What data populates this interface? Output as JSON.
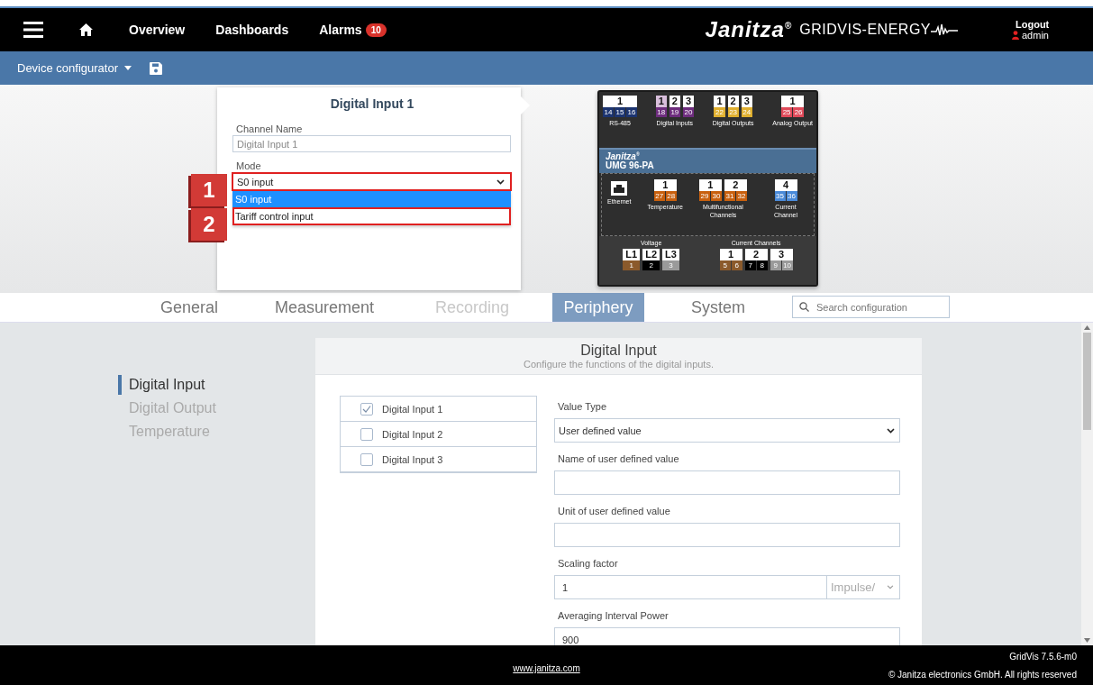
{
  "header": {
    "nav": [
      {
        "kind": "menu"
      },
      {
        "kind": "home"
      },
      {
        "kind": "link",
        "label": "Overview"
      },
      {
        "kind": "link",
        "label": "Dashboards"
      },
      {
        "kind": "link",
        "label": "Alarms",
        "badge": "10"
      }
    ],
    "logo": "Janitza$^{®}$",
    "product": "GRIDVIS-ENERGY",
    "logout": "Logout",
    "user": "admin"
  },
  "toolbar": {
    "menu": "Device configurator"
  },
  "popup": {
    "title": "Digital Input 1",
    "channel_label": "Channel Name",
    "channel_value": "Digital Input 1",
    "mode_label": "Mode",
    "mode_value": "S0 input",
    "mode_highlighted": true,
    "options": [
      {
        "label": "S0 input",
        "selected": true,
        "highlighted": false
      },
      {
        "label": "Tariff control input",
        "selected": false,
        "highlighted": true
      }
    ]
  },
  "callouts": [
    {
      "number": "1"
    },
    {
      "number": "2"
    }
  ],
  "device": {
    "brand": "Janitza$^{®}$",
    "model": "UMG 96-PA",
    "top": [
      {
        "kind": "terminals",
        "label": "RS-485",
        "blocks": [
          {
            "number": "1",
            "selected": false,
            "terminals": [
              {
                "label": "14",
                "color": "#1c3470"
              },
              {
                "label": "15",
                "color": "#1c3470"
              },
              {
                "label": "16",
                "color": "#1c3470"
              }
            ]
          }
        ]
      },
      {
        "kind": "terminals",
        "label": "Digital Inputs",
        "blocks": [
          {
            "number": "1",
            "selected": true,
            "terminals": [
              {
                "label": "18",
                "color": "#6e2d7e"
              }
            ]
          },
          {
            "number": "2",
            "selected": false,
            "terminals": [
              {
                "label": "19",
                "color": "#6e2d7e"
              }
            ]
          },
          {
            "number": "3",
            "selected": false,
            "terminals": [
              {
                "label": "20",
                "color": "#6e2d7e"
              }
            ]
          }
        ]
      },
      {
        "kind": "terminals",
        "label": "Digital Outputs",
        "blocks": [
          {
            "number": "1",
            "selected": false,
            "terminals": [
              {
                "label": "22",
                "color": "#e0b030"
              }
            ]
          },
          {
            "number": "2",
            "selected": false,
            "terminals": [
              {
                "label": "23",
                "color": "#e0b030"
              }
            ]
          },
          {
            "number": "3",
            "selected": false,
            "terminals": [
              {
                "label": "24",
                "color": "#e0b030"
              }
            ]
          }
        ]
      },
      {
        "kind": "terminals",
        "label": "Analog Output",
        "blocks": [
          {
            "number": "1",
            "selected": false,
            "terminals": [
              {
                "label": "25",
                "color": "#e04a5a"
              },
              {
                "label": "26",
                "color": "#e04a5a"
              }
            ]
          }
        ]
      }
    ],
    "middle": [
      {
        "kind": "ethernet",
        "label": "Ethernet"
      },
      {
        "kind": "terminals",
        "label": "Temperature",
        "blocks": [
          {
            "number": "1",
            "selected": false,
            "terminals": [
              {
                "label": "27",
                "color": "#c8600e"
              },
              {
                "label": "28",
                "color": "#c8600e"
              }
            ]
          }
        ]
      },
      {
        "kind": "terminals",
        "label": "Multifunctional Channels",
        "blocks": [
          {
            "number": "1",
            "selected": false,
            "terminals": [
              {
                "label": "29",
                "color": "#c8600e"
              },
              {
                "label": "30",
                "color": "#c8600e"
              }
            ]
          },
          {
            "number": "2",
            "selected": false,
            "terminals": [
              {
                "label": "31",
                "color": "#c8600e"
              },
              {
                "label": "32",
                "color": "#c8600e"
              }
            ]
          }
        ]
      },
      {
        "kind": "terminals",
        "label": "Current Channel",
        "blocks": [
          {
            "number": "4",
            "selected": false,
            "terminals": [
              {
                "label": "35",
                "color": "#4a8ad8"
              },
              {
                "label": "36",
                "color": "#4a8ad8"
              }
            ]
          }
        ]
      }
    ],
    "bottom": [
      {
        "kind": "terminals",
        "label": "Voltage",
        "blocks": [
          {
            "number": "L1",
            "selected": false,
            "terminals": [
              {
                "label": "1",
                "color": "#8b5a2b"
              }
            ]
          },
          {
            "number": "L2",
            "selected": false,
            "terminals": [
              {
                "label": "2",
                "color": "#000000"
              }
            ]
          },
          {
            "number": "L3",
            "selected": false,
            "terminals": [
              {
                "label": "3",
                "color": "#9a9a9a"
              }
            ]
          }
        ]
      },
      {
        "kind": "terminals",
        "label": "Current Channels",
        "blocks": [
          {
            "number": "1",
            "selected": false,
            "terminals": [
              {
                "label": "5",
                "color": "#8b5a2b"
              },
              {
                "label": "6",
                "color": "#8b5a2b"
              }
            ]
          },
          {
            "number": "2",
            "selected": false,
            "terminals": [
              {
                "label": "7",
                "color": "#000000"
              },
              {
                "label": "8",
                "color": "#000000"
              }
            ]
          },
          {
            "number": "3",
            "selected": false,
            "terminals": [
              {
                "label": "9",
                "color": "#9a9a9a"
              },
              {
                "label": "10",
                "color": "#9a9a9a"
              }
            ]
          }
        ]
      }
    ]
  },
  "tabs": [
    {
      "label": "General",
      "selected": false,
      "disabled": false
    },
    {
      "label": "Measurement",
      "selected": false,
      "disabled": false
    },
    {
      "label": "Recording",
      "selected": false,
      "disabled": true
    },
    {
      "label": "Periphery",
      "selected": true,
      "disabled": false
    },
    {
      "label": "System",
      "selected": false,
      "disabled": false
    }
  ],
  "search": {
    "placeholder": "Search configuration"
  },
  "sidebar": {
    "items": [
      {
        "label": "Digital Input",
        "selected": true
      },
      {
        "label": "Digital Output",
        "selected": false
      },
      {
        "label": "Temperature",
        "selected": false
      }
    ]
  },
  "card": {
    "title": "Digital Input",
    "subtitle": "Configure the functions of the digital inputs.",
    "channels": [
      {
        "label": "Digital Input 1",
        "checked": true
      },
      {
        "label": "Digital Input 2",
        "checked": false
      },
      {
        "label": "Digital Input 3",
        "checked": false
      }
    ],
    "fields": [
      {
        "kind": "select",
        "label": "Value Type",
        "value": "User defined value"
      },
      {
        "kind": "input",
        "label": "Name of user defined value"
      },
      {
        "kind": "input",
        "label": "Unit of user defined value"
      },
      {
        "kind": "input-unit",
        "label": "Scaling factor",
        "value": "1",
        "unit": "Impulse/"
      },
      {
        "kind": "input",
        "label": "Averaging Interval Power",
        "value": "900"
      }
    ]
  },
  "footer": {
    "link": "www.janitza.com",
    "version": "GridVis 7.5.6-m0",
    "copyright": "© Janitza electronics GmbH. All rights reserved"
  }
}
